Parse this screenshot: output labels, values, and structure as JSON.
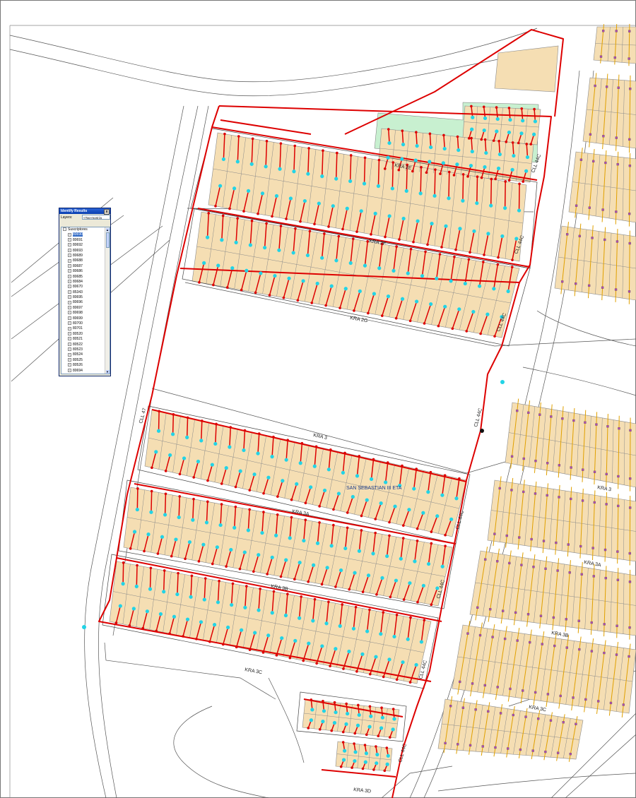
{
  "identify": {
    "title": "Identify Results",
    "close": "x",
    "layers_label": "Layers:",
    "layers_value": "<Top-most la",
    "root": "Suscriptores",
    "items": [
      "80690",
      "80691",
      "80692",
      "80693",
      "80689",
      "80688",
      "80687",
      "80686",
      "80685",
      "80684",
      "80670",
      "85343",
      "80695",
      "80696",
      "80697",
      "80698",
      "80699",
      "80700",
      "80701",
      "80520",
      "80521",
      "80522",
      "80523",
      "80524",
      "80525",
      "80526",
      "80694"
    ],
    "selected_index": 0
  },
  "labels": {
    "kra_2e": "KRA 2E",
    "kra_2f": "KRA 2F",
    "kra_2g": "KRA 2G",
    "kra_3": "KRA 3",
    "kra_3a": "KRA 3A",
    "kra_3b": "KRA 3B",
    "kra_3c": "KRA 3C",
    "kra_3d": "KRA 3D",
    "cll_44c_a": "CLL 44C",
    "cll_44c_b": "CLL 44C",
    "cll_44c_c": "CLL 44C",
    "cll_44c_d": "CLL 44C",
    "cll_44c_e": "CLL 44C",
    "cll_44c_f": "CLL 44C",
    "cll_44c_g": "CLL 44C",
    "cll_44c_h": "CLL 44C",
    "cll_44c_i": "CLL 44C",
    "cll_47": "CLL 47",
    "neighborhood": "SAN SEBASTIAN III ETA",
    "east_kra_3": "KRA 3",
    "east_kra_3a": "KRA 3A",
    "east_kra_3b": "KRA 3B",
    "east_kra_3c": "KRA 3C"
  },
  "colors": {
    "parcel_fill": "#f5deb3",
    "parcel_stroke": "#8a8a8a",
    "network": "#dd0000",
    "subscriber": "#22d3e6",
    "green_area": "#c8f0d0",
    "east_network": "#e0a000",
    "street_line": "#555555"
  },
  "icons": {
    "close": "close-icon",
    "expand": "plus-icon",
    "subscriber": "subscriber-point-icon",
    "valve": "node-point-icon"
  }
}
